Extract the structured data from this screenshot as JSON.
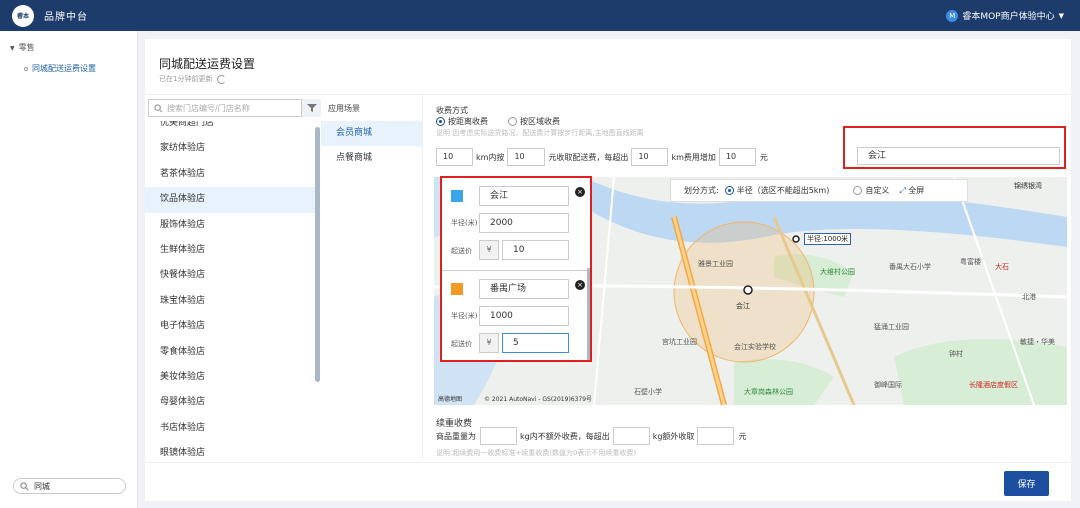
{
  "topbar": {
    "logo_text": "睿本",
    "brand": "品牌中台",
    "user_badge": "M",
    "user": "睿本MOP商户体验中心"
  },
  "sidebar": {
    "group": "零售",
    "item": "同城配送运费设置",
    "search_value": "同城"
  },
  "page": {
    "title": "同城配送运费设置",
    "updated": "已在1分钟前更新"
  },
  "stores": {
    "search_placeholder": "搜索门店编号/门店名称",
    "items": [
      "优美商超门店",
      "家纺体验店",
      "茗茶体验店",
      "饮品体验店",
      "服饰体验店",
      "生鲜体验店",
      "快餐体验店",
      "珠宝体验店",
      "电子体验店",
      "零食体验店",
      "美妆体验店",
      "母婴体验店",
      "书店体验店",
      "眼镜体验店"
    ],
    "active_index": 3
  },
  "scene": {
    "header": "应用场景",
    "items": [
      "会员商城",
      "点餐商城"
    ],
    "active_index": 0
  },
  "charge": {
    "label": "收费方式",
    "opt_distance": "按距离收费",
    "opt_region": "按区域收费",
    "note": "说明:因考虑实际送货路况，配送费计算按步行距离,主地图直线距离",
    "within_km": "10",
    "within_text": "km内按",
    "base_fee": "10",
    "base_text": "元收取配送费，每超出",
    "per_km": "10",
    "per_km_text": "km费用增加",
    "add_fee": "10",
    "unit_yuan": "元"
  },
  "city": {
    "value": "会江"
  },
  "zones": [
    {
      "color": "#3aa5e8",
      "name": "会江",
      "radius_label": "半径(米)",
      "radius": "2000",
      "min_label": "起送价",
      "currency": "¥",
      "min": "10"
    },
    {
      "color": "#f59a23",
      "name": "番禺广场",
      "radius_label": "半径(米)",
      "radius": "1000",
      "min_label": "起送价",
      "currency": "¥",
      "min": "5"
    }
  ],
  "divmode": {
    "label": "划分方式:",
    "opt_radius": "半径（选区不能超出5km)",
    "opt_custom": "自定义",
    "fullscreen": "全屏"
  },
  "map": {
    "labels": [
      "锦绣银湾",
      "雅景工业园",
      "大维村公园",
      "番禺大石小学",
      "粤富楼",
      "大石",
      "会江",
      "宫坑工业园",
      "会江实验学校",
      "猛涌工业园",
      "敏捷・华美",
      "御峰国际",
      "钟村",
      "石壁小学",
      "大章岗森林公园",
      "长隆酒店度假区",
      "半径:1000米",
      "北港"
    ],
    "copyright": "© 2021 AutoNavi - GS(2019)6379号",
    "logo": "高德地图"
  },
  "weight": {
    "title": "续重收费",
    "prefix": "商品重量为",
    "mid": "kg内不额外收费，每超出",
    "mid2": "kg额外收取",
    "unit": "元",
    "note": "说明:超续费用一收费标准+续重收费(数值为0表示不用续重收费)"
  },
  "actions": {
    "save": "保存"
  }
}
